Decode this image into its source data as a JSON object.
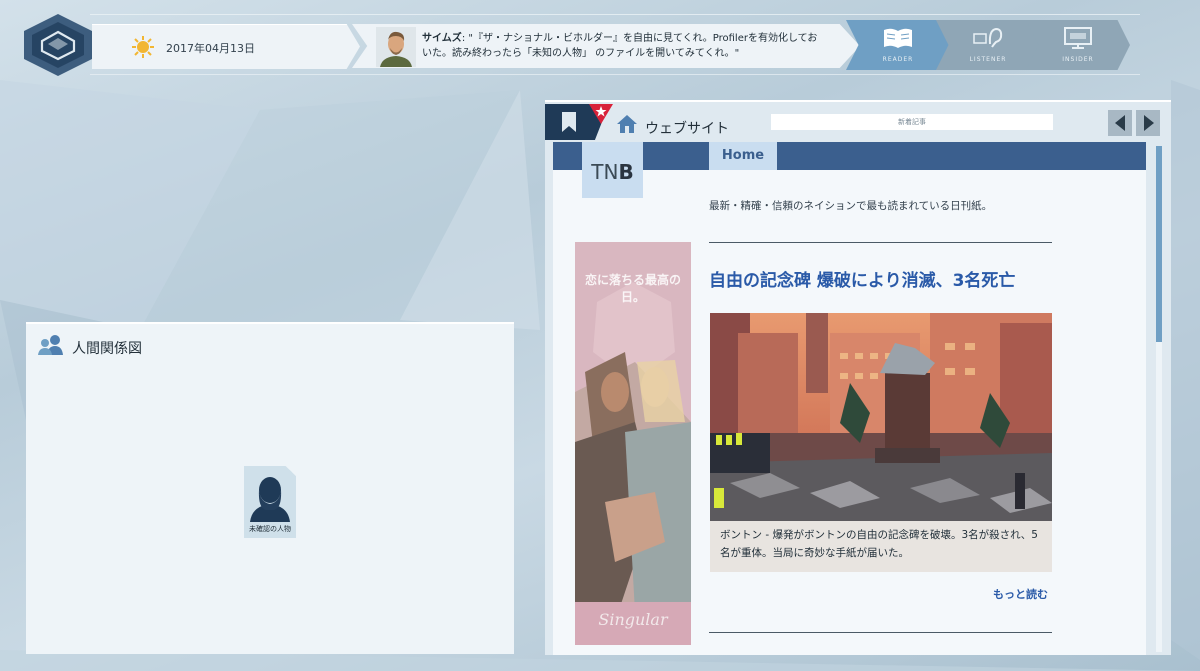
{
  "topbar": {
    "date": "2017年04月13日",
    "message": {
      "speaker": "サイムズ",
      "text": ": \"『ザ・ナショナル・ビホルダー』を自由に見てくれ。Profilerを有効化しておいた。読み終わったら「未知の人物」 のファイルを開いてみてくれ。\""
    },
    "modes": [
      {
        "label": "READER",
        "icon": "book-icon",
        "active": true
      },
      {
        "label": "LISTENER",
        "icon": "ear-icon",
        "active": false
      },
      {
        "label": "INSIDER",
        "icon": "monitor-icon",
        "active": false
      }
    ]
  },
  "relationship": {
    "title": "人間関係図",
    "person_label": "未確認の人物"
  },
  "browser": {
    "title": "ウェブサイト",
    "url": "新着記事",
    "site": {
      "logo_light": "TN",
      "logo_bold": "B",
      "nav_home": "Home",
      "tagline": "最新・精確・信頼のネイションで最も読まれている日刊紙。",
      "headline": "自由の記念碑 爆破により消滅、3名死亡",
      "caption": "ボントン - 爆発がボントンの自由の記念碑を破壊。3名が殺され、5名が重体。当局に奇妙な手紙が届いた。",
      "read_more": "もっと読む",
      "ad": {
        "headline": "恋に落ちる最高の日。",
        "brand": "Singular"
      }
    }
  },
  "colors": {
    "accent": "#6f9fc4",
    "nav_strip": "#3b5f8e",
    "headline": "#2a5aa8",
    "panel": "#eef4f8"
  }
}
